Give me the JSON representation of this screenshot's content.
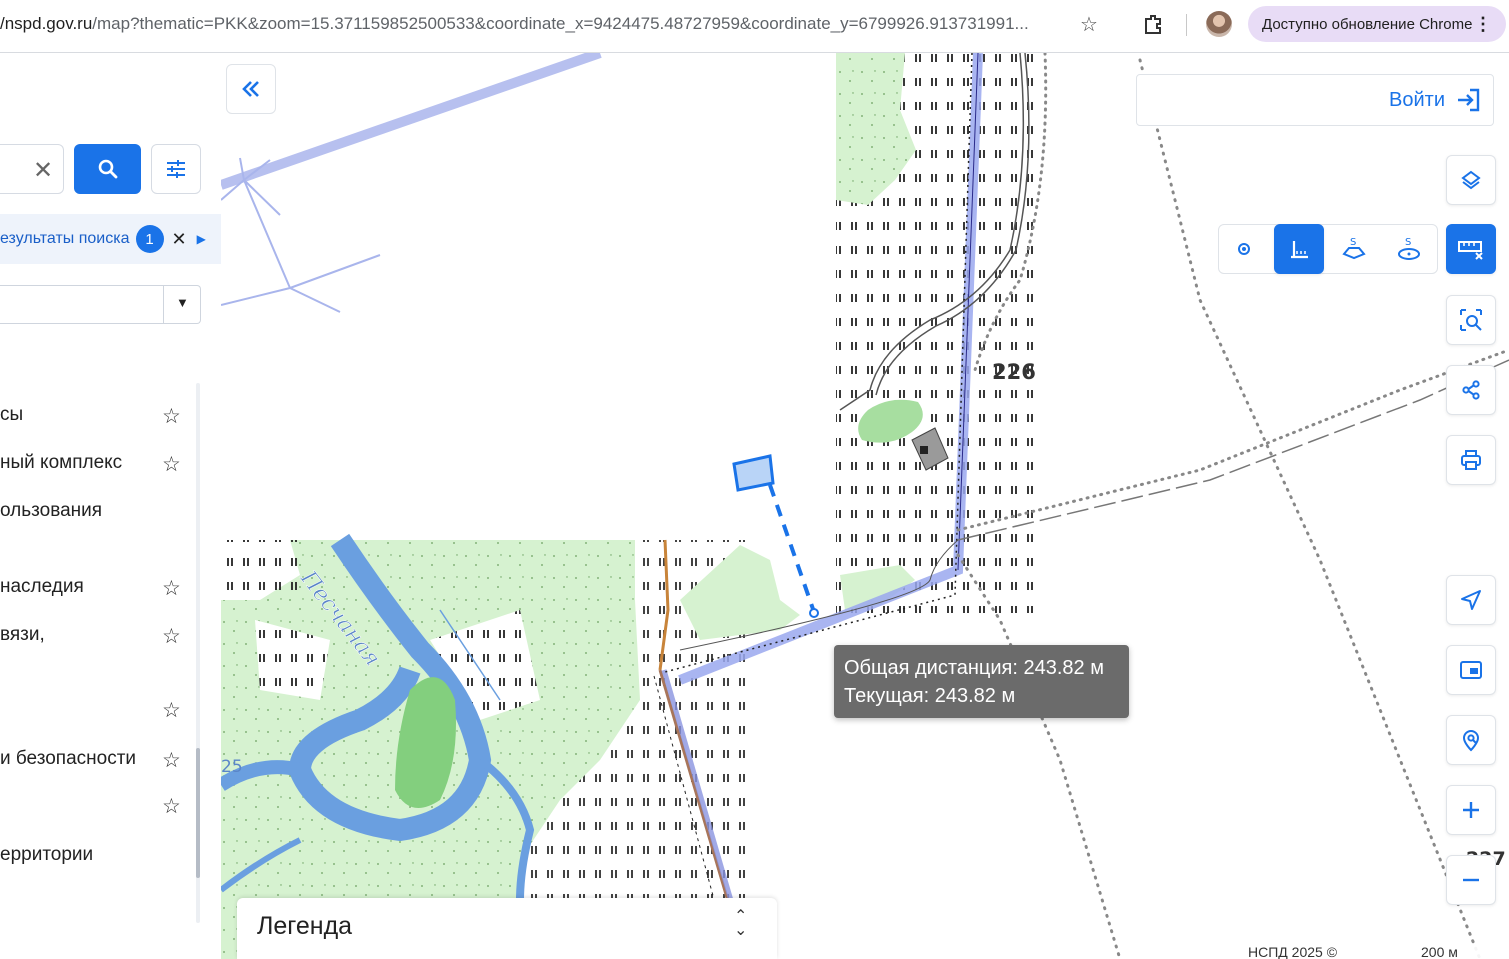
{
  "browser": {
    "url_host": "/nspd.gov.ru",
    "url_rest": "/map?thematic=PKK&zoom=15.371159852500533&coordinate_x=9424475.48727959&coordinate_y=6799926.913731991...",
    "update_label": "Доступно обновление Chrome"
  },
  "sidebar": {
    "results_label": "езультаты поиска",
    "results_count": "1",
    "layers": [
      {
        "label": "сы",
        "starred": true
      },
      {
        "label": "ный комплекс",
        "starred": true
      },
      {
        "label": "ользования",
        "starred": false
      },
      {
        "label": "наследия",
        "starred": true
      },
      {
        "label": "вязи,",
        "starred": true
      },
      {
        "label": "",
        "starred": true
      },
      {
        "label": "и безопасности",
        "starred": true
      },
      {
        "label": "",
        "starred": true
      },
      {
        "label": "ерритории",
        "starred": false
      }
    ]
  },
  "map": {
    "login_label": "Войти",
    "tooltip_total": "Общая дистанция: 243.82 м",
    "tooltip_current": "Текущая: 243.82 м",
    "legend_label": "Легенда",
    "attribution": "НСПД 2025 ©",
    "scale_label": "200 м",
    "river_label": "Песчаная",
    "elevation_226": "226",
    "elevation_25": "25",
    "elevation_227": "227",
    "colors": {
      "accent": "#1a73e8",
      "forest": "#d6f2d0",
      "river": "#6a9fe0",
      "parcel": "#9aa8ee"
    }
  }
}
